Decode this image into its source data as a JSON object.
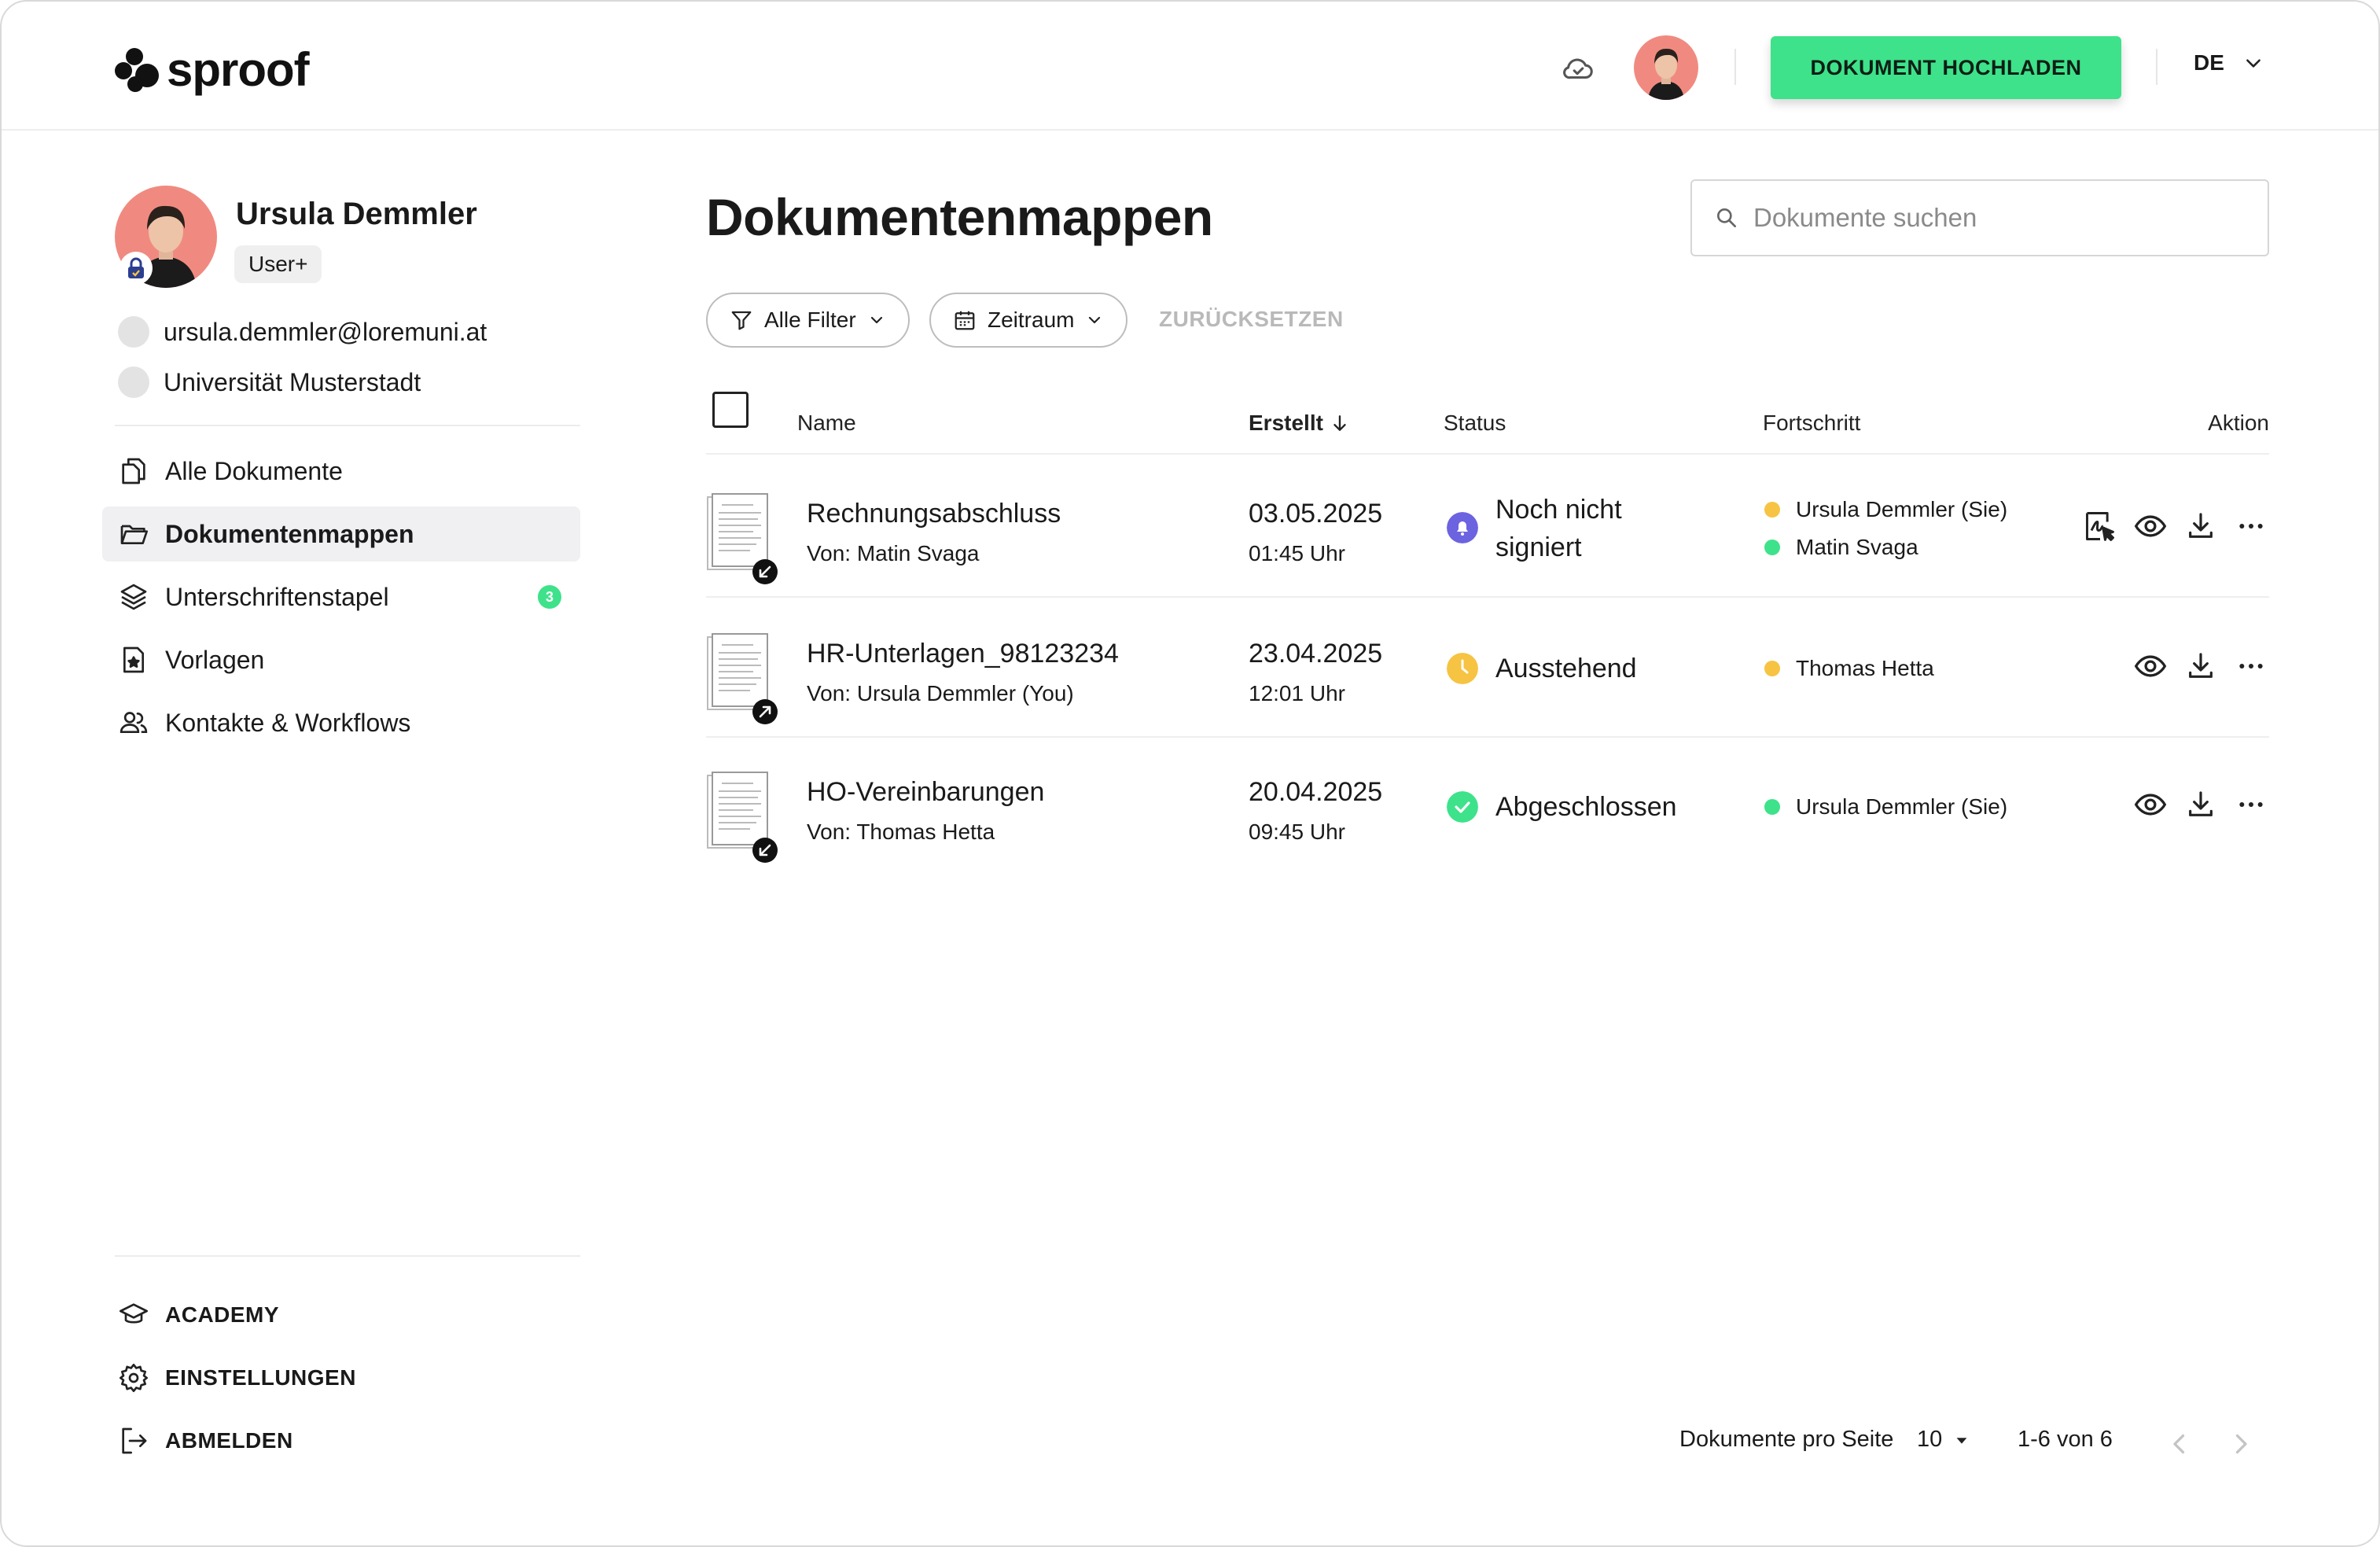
{
  "header": {
    "logo_text": "sproof",
    "upload_label": "DOKUMENT HOCHLADEN",
    "language": "DE",
    "accent_color": "#3ee28a"
  },
  "profile": {
    "name": "Ursula Demmler",
    "role": "User+",
    "email": "ursula.demmler@loremuni.at",
    "organization": "Universität Musterstadt"
  },
  "nav": [
    {
      "label": "Alle Dokumente",
      "icon": "documents-icon"
    },
    {
      "label": "Dokumentenmappen",
      "icon": "folder-icon",
      "active": true
    },
    {
      "label": "Unterschriftenstapel",
      "icon": "layers-icon",
      "count": "3"
    },
    {
      "label": "Vorlagen",
      "icon": "template-icon"
    },
    {
      "label": "Kontakte & Workflows",
      "icon": "contacts-icon"
    }
  ],
  "bottom_nav": [
    {
      "label": "ACADEMY",
      "icon": "graduation-cap-icon"
    },
    {
      "label": "EINSTELLUNGEN",
      "icon": "gear-icon"
    },
    {
      "label": "ABMELDEN",
      "icon": "logout-icon"
    }
  ],
  "main": {
    "title": "Dokumentenmappen",
    "search_placeholder": "Dokumente suchen",
    "filters": {
      "all_filters": "Alle Filter",
      "period": "Zeitraum",
      "reset": "ZURÜCKSETZEN"
    },
    "columns": {
      "name": "Name",
      "created": "Erstellt",
      "status": "Status",
      "progress": "Fortschritt",
      "action": "Aktion"
    },
    "rows": [
      {
        "title": "Rechnungsabschluss",
        "from": "Von: Matin Svaga",
        "date": "03.05.2025",
        "time": "01:45 Uhr",
        "status_line1": "Noch nicht",
        "status_line2": "signiert",
        "status_color": "#6c63e0",
        "direction": "incoming",
        "signers": [
          {
            "name": "Ursula Demmler (Sie)",
            "color": "#f6c343"
          },
          {
            "name": "Matin Svaga",
            "color": "#3ee28a"
          }
        ]
      },
      {
        "title": "HR-Unterlagen_98123234",
        "from": "Von: Ursula Demmler (You)",
        "date": "23.04.2025",
        "time": "12:01 Uhr",
        "status_line1": "Ausstehend",
        "status_color": "#f6c343",
        "direction": "outgoing",
        "signers": [
          {
            "name": "Thomas Hetta",
            "color": "#f6c343"
          }
        ]
      },
      {
        "title": "HO-Vereinbarungen",
        "from": "Von: Thomas Hetta",
        "date": "20.04.2025",
        "time": "09:45 Uhr",
        "status_line1": "Abgeschlossen",
        "status_color": "#3ee28a",
        "direction": "incoming",
        "signers": [
          {
            "name": "Ursula Demmler (Sie)",
            "color": "#3ee28a"
          }
        ]
      }
    ]
  },
  "footer": {
    "per_page_label": "Dokumente pro Seite",
    "per_page_value": "10",
    "range": "1-6 von 6"
  }
}
